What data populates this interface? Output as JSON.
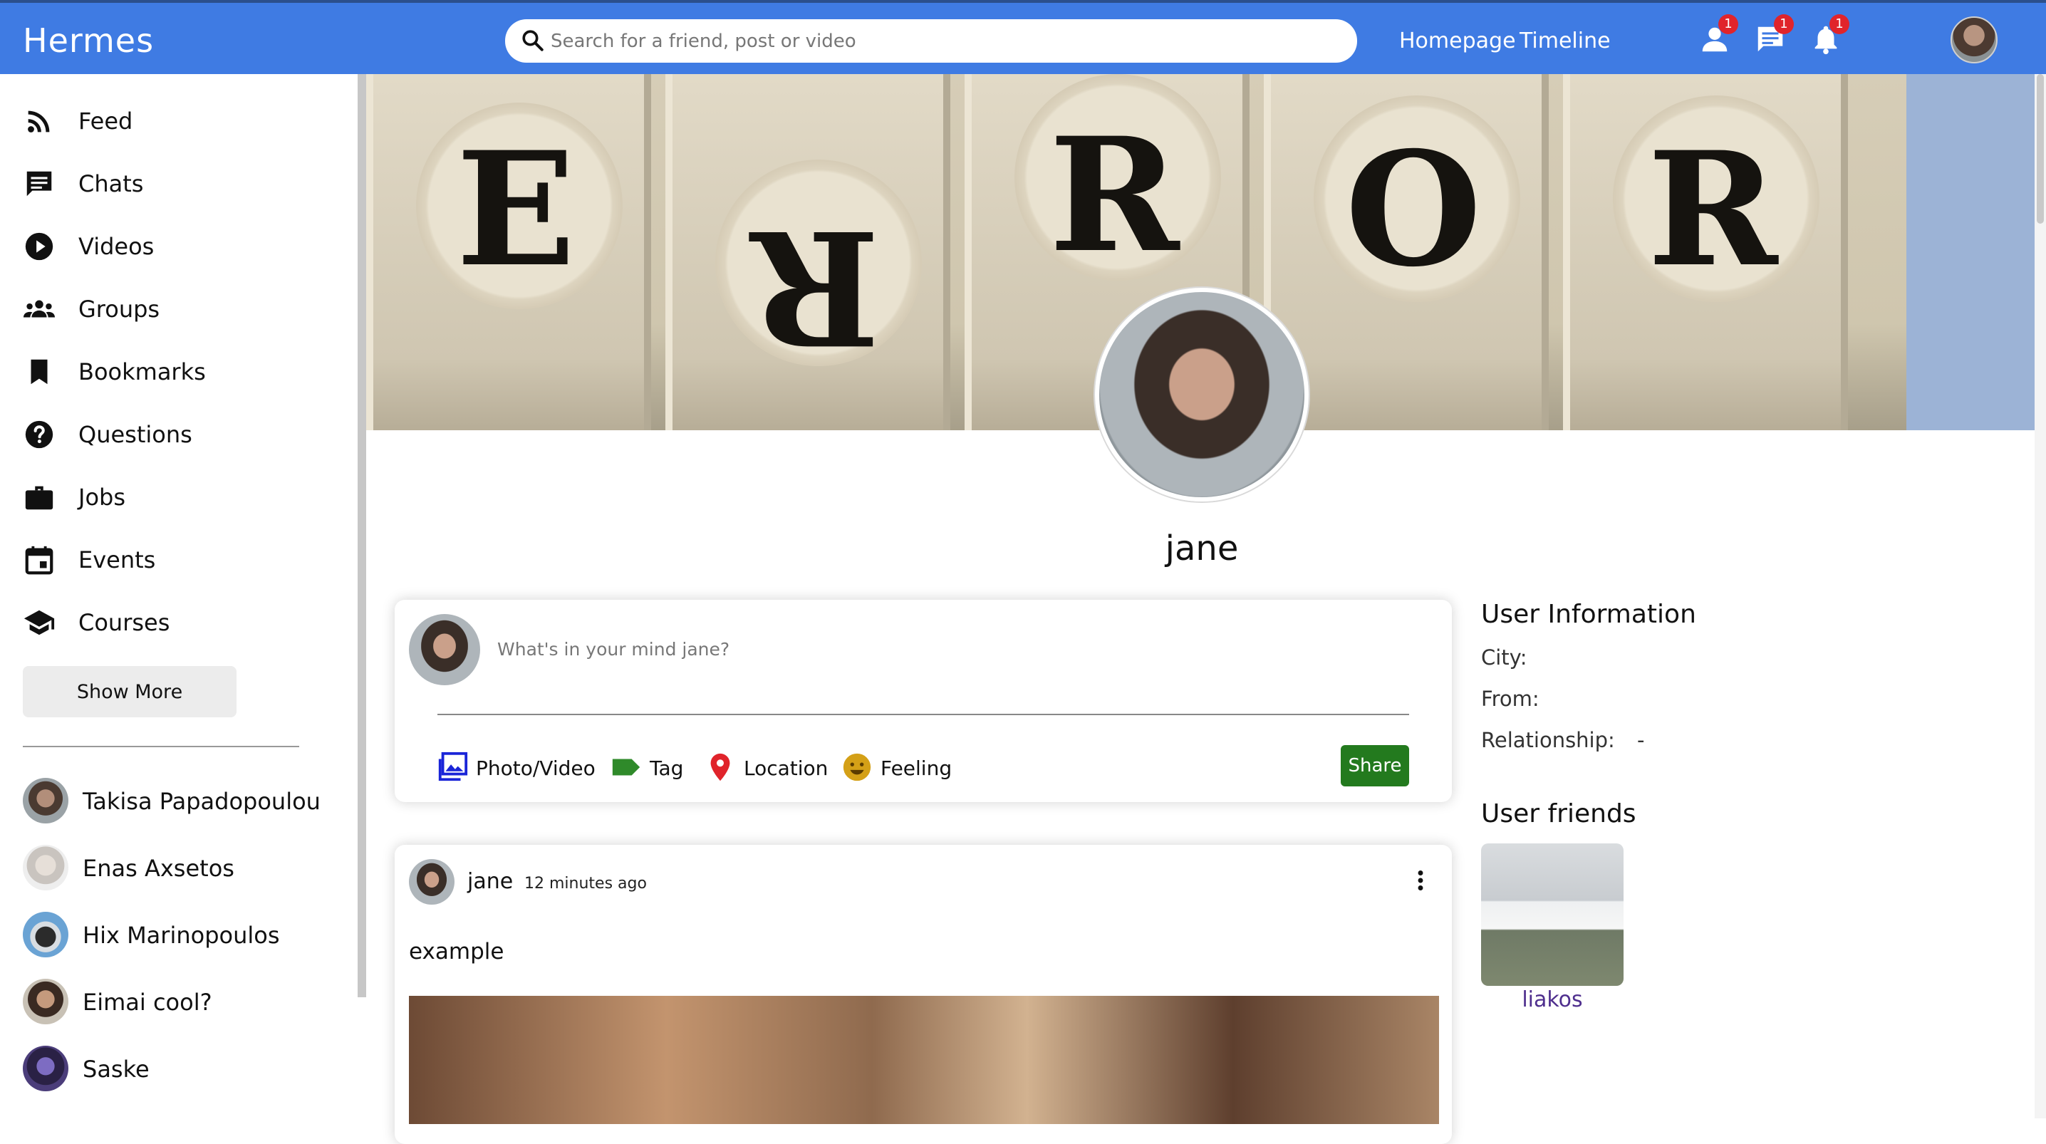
{
  "header": {
    "logo": "Hermes",
    "search_placeholder": "Search for a friend, post or video",
    "links": [
      "Homepage",
      "Timeline"
    ],
    "notifications": {
      "friend_requests": "1",
      "messages": "1",
      "alerts": "1"
    },
    "accent_color": "#3f7be3"
  },
  "sidebar": {
    "items": [
      {
        "label": "Feed",
        "icon": "rss-feed-icon"
      },
      {
        "label": "Chats",
        "icon": "chat-icon"
      },
      {
        "label": "Videos",
        "icon": "play-circle-icon"
      },
      {
        "label": "Groups",
        "icon": "groups-icon"
      },
      {
        "label": "Bookmarks",
        "icon": "bookmark-icon"
      },
      {
        "label": "Questions",
        "icon": "help-circle-icon"
      },
      {
        "label": "Jobs",
        "icon": "briefcase-icon"
      },
      {
        "label": "Events",
        "icon": "calendar-icon"
      },
      {
        "label": "Courses",
        "icon": "school-icon"
      }
    ],
    "show_more": "Show More",
    "friends": [
      "Takisa Papadopoulou",
      "Enas Axsetos",
      "Hix Marinopoulos",
      "Eimai cool?",
      "Saske"
    ]
  },
  "profile": {
    "cover_letters": [
      "E",
      "R",
      "R",
      "O",
      "R"
    ],
    "name": "jane"
  },
  "share": {
    "placeholder": "What's in your mind jane?",
    "options": [
      {
        "label": "Photo/Video",
        "icon": "photo-library-icon",
        "color": "#1a25d8"
      },
      {
        "label": "Tag",
        "icon": "label-icon",
        "color": "#2f8a2a"
      },
      {
        "label": "Location",
        "icon": "location-pin-icon",
        "color": "#e0242b"
      },
      {
        "label": "Feeling",
        "icon": "emoji-icon",
        "color": "#d4a017"
      }
    ],
    "button": "Share",
    "button_color": "#237a1e"
  },
  "post": {
    "author": "jane",
    "time": "12 minutes ago",
    "text": "example"
  },
  "user_info": {
    "title": "User Information",
    "rows": [
      {
        "label": "City:",
        "value": ""
      },
      {
        "label": "From:",
        "value": ""
      },
      {
        "label": "Relationship:",
        "value": "-"
      }
    ]
  },
  "user_friends": {
    "title": "User friends",
    "friends": [
      "liakos"
    ]
  }
}
